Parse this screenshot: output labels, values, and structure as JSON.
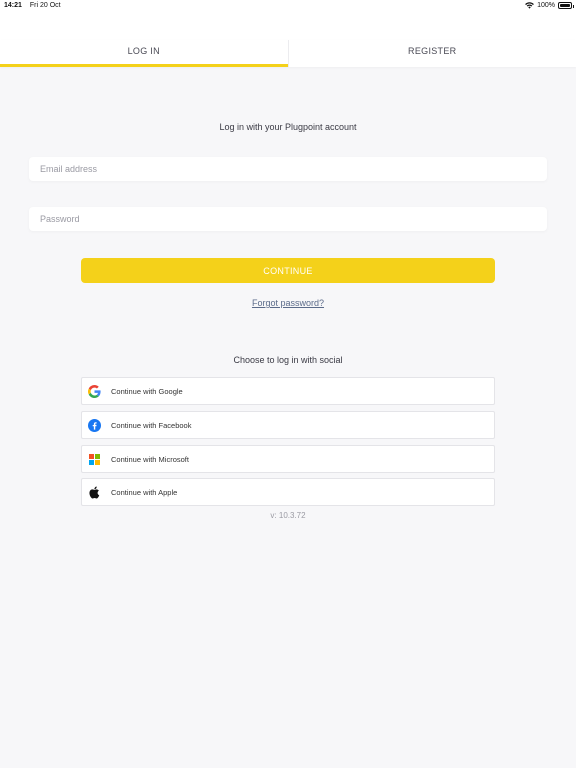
{
  "status_bar": {
    "time": "14:21",
    "date": "Fri 20 Oct",
    "battery": "100%"
  },
  "tabs": [
    {
      "label": "LOG IN",
      "active": true
    },
    {
      "label": "REGISTER",
      "active": false
    }
  ],
  "login": {
    "subtitle": "Log in with your Plugpoint account",
    "email_placeholder": "Email address",
    "email_value": "",
    "password_placeholder": "Password",
    "password_value": "",
    "continue_label": "CONTINUE",
    "forgot_label": "Forgot password?"
  },
  "social": {
    "title": "Choose to log in with social",
    "buttons": [
      {
        "label": "Continue with Google",
        "icon": "google-icon"
      },
      {
        "label": "Continue with Facebook",
        "icon": "facebook-icon"
      },
      {
        "label": "Continue with Microsoft",
        "icon": "microsoft-icon"
      },
      {
        "label": "Continue with Apple",
        "icon": "apple-icon"
      }
    ]
  },
  "version": "v: 10.3.72",
  "colors": {
    "accent": "#f4d11a",
    "background": "#f7f7f9",
    "link": "#5b6b8a",
    "facebook": "#1877f2"
  }
}
